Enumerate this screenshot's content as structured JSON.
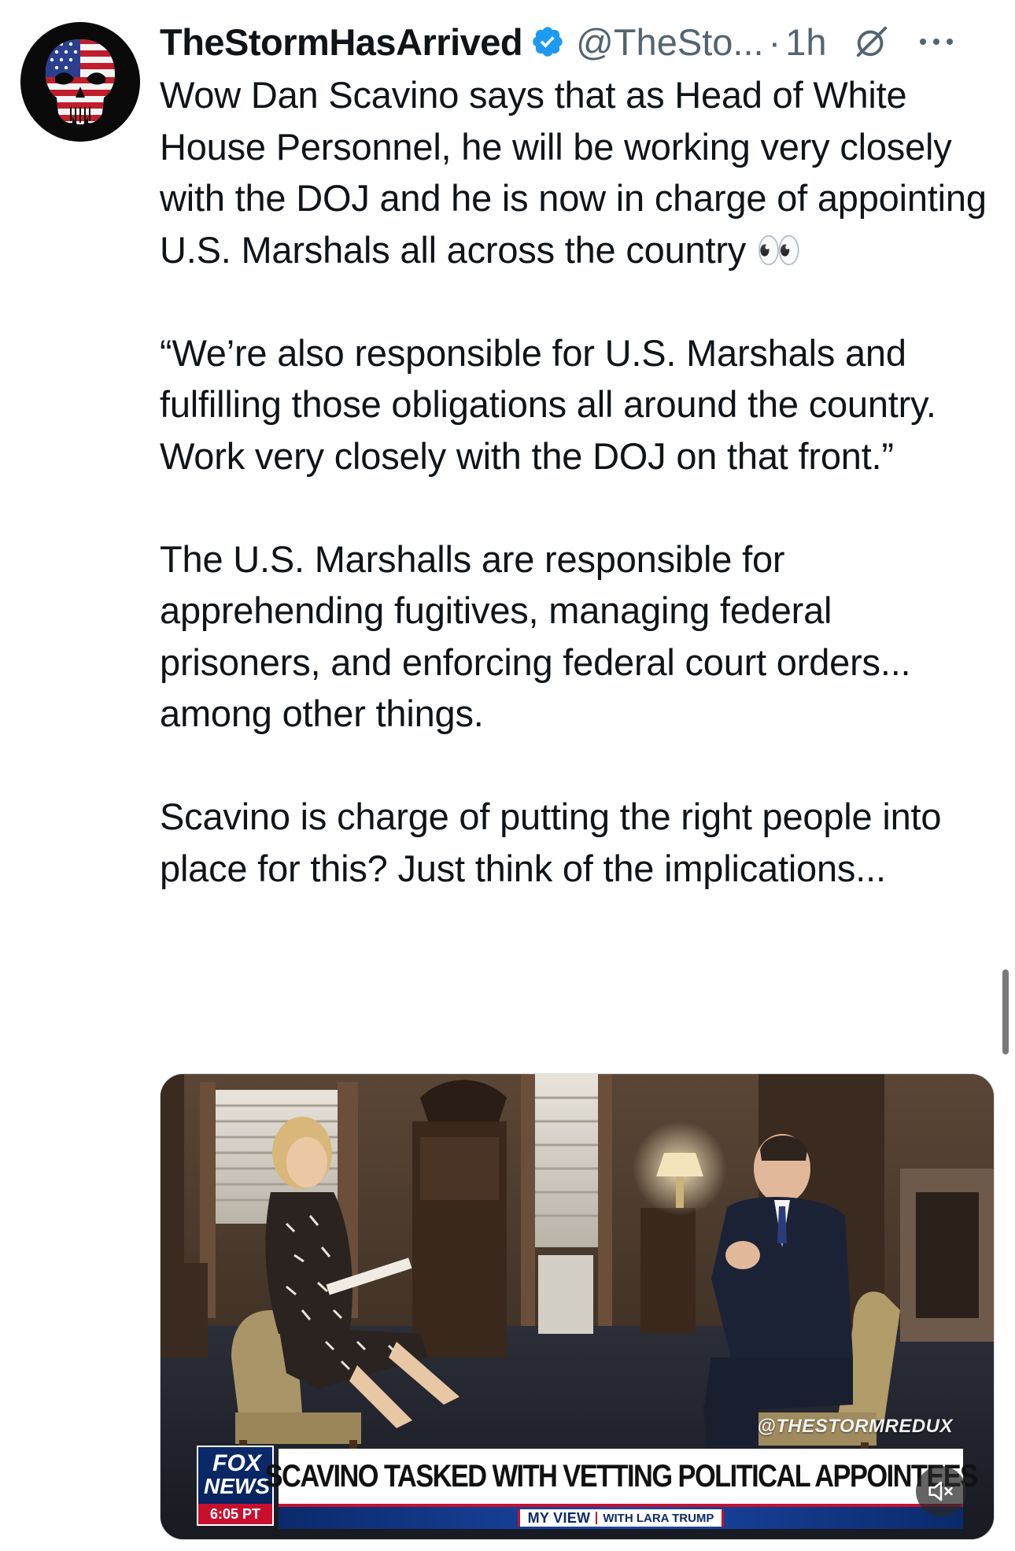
{
  "tweet": {
    "display_name": "TheStormHasArrived",
    "verified_icon": "verified-badge-icon",
    "handle": "@TheSto...",
    "separator": "·",
    "time": "1h",
    "icons": {
      "grok": "grok-icon",
      "more": "more-options-icon",
      "avatar": "punisher-flag-skull"
    },
    "paragraphs": [
      "Wow Dan Scavino says that as Head of White House Personnel, he will be working very closely with the DOJ and he is now in charge of appointing U.S. Marshals all across the country 👀",
      "“We’re also responsible for U.S. Marshals and fulfilling those obligations all around the country. Work very closely with the DOJ on that front.”",
      "The U.S. Marshalls are responsible for apprehending fugitives, managing federal prisoners, and enforcing federal court orders... among other things.",
      "Scavino is charge of putting the right people into place for this? Just think of the implications..."
    ]
  },
  "media": {
    "watermark": "@THESTORMREDUX",
    "network_logo_top": "FOX",
    "network_logo_bottom": "NEWS",
    "network_time": "6:05 PT",
    "chyron": "SCAVINO TASKED WITH VETTING POLITICAL APPOINTEES",
    "show_name": "MY VIEW",
    "show_host": "WITH LARA TRUMP",
    "mute_icon": "muted-speaker-icon"
  },
  "colors": {
    "text_primary": "#0f1419",
    "text_secondary": "#536471",
    "verified_blue": "#1d9bf0",
    "fox_blue": "#0b2a6b",
    "fox_red": "#c8102e"
  }
}
